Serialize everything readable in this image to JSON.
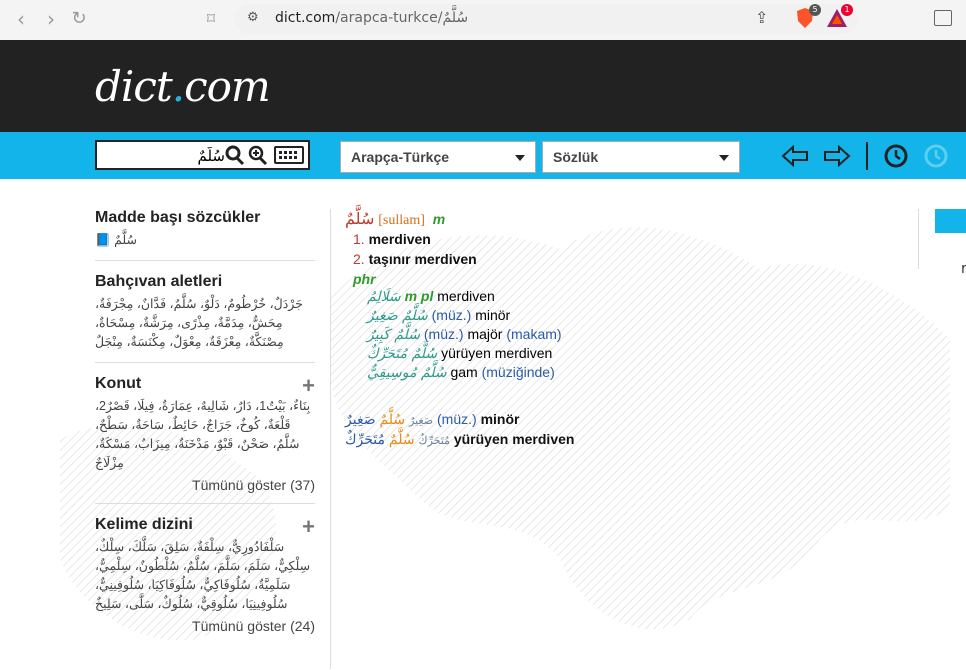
{
  "browser": {
    "url_host": "dict.com",
    "url_path": "/arapca-turkce/سُلَّمٌ",
    "brave_badge": "5",
    "bat_badge": "1"
  },
  "site": {
    "logo_main": "dict",
    "logo_dot": ".",
    "logo_tld": "com"
  },
  "search": {
    "value": "سُلَّمٌ",
    "language_pair": "Arapça-Türkçe",
    "dictionary": "Sözlük"
  },
  "sidebar": {
    "headwords": {
      "title": "Madde başı sözcükler",
      "items_text": "سُلَّمٌ"
    },
    "garden": {
      "title": "Bahçıvan aletleri",
      "text": "جَرْدَلٌ، خُرْطُومٌ، دَلْوٌ، سُلَّمٌ، فَدَّانٌ، مِجْرَفَةٌ، مِحَشٌّ، مِدَمَّةٌ، مِذْرًى، مِرَشَّةٌ، مِسْحَاةٌ، مِصْنَكَّةٌ، مِعْزَقَةٌ، مِعْوَلٌ، مِكْنَسَةٌ، مِنْجَلٌ"
    },
    "housing": {
      "title": "Konut",
      "text": "بِنَاءٌ، بَيْتٌ1، دَارٌ، شَالِيهٌ، عِمَارَةٌ، فِيلَا، قَصْرٌ2، قَلْعَةٌ، كُوخٌ، جَرَاجٌ، حَائِطٌ، سَاحَةٌ، سَطْحٌ، سُلَّمٌ، صَحْنٌ، قَبْوٌ، مَدْخَنَةٌ، مِيزَابٌ، مَسْكَةٌ، مِزْلَاجٌ",
      "show_all": "Tümünü göster (37)"
    },
    "index": {
      "title": "Kelime dizini",
      "text": "سَلْفَادُورِيٌّ، سِلْفَةٌ، سَلِقَ، سَلَّكَ، سِلْكٌ، سِلْكِيٌّ، سَلَمَ، سَلَّمَ، سُلَّمٌ، سُلْطُونٌ، سِلْمِيٌّ، سَلَمِيَّةٌ، سُلُوفَاكِيٌّ، سُلُوفَاكِيَا، سُلُوفِينِيٌّ، سُلُوفِينِيَا، سُلُوقِيٌّ، سُلُوكٌ، سَلَّى، سَلِيخٌ",
      "show_all": "Tümünü göster (24)"
    }
  },
  "entry": {
    "headword": "سُلَّمٌ",
    "transcription": "[sullam]",
    "gender": "m",
    "senses": [
      {
        "n": "1.",
        "text": "merdiven"
      },
      {
        "n": "2.",
        "text": "taşınır merdiven"
      }
    ],
    "phr_label": "phr",
    "phrases": [
      {
        "ar": "سَلَالِمُ",
        "pos": "m pl",
        "tr": "merdiven",
        "note": ""
      },
      {
        "ar": "سُلَّمٌ صَغِيرٌ",
        "muz": "(müz.)",
        "tr": "minör",
        "note": ""
      },
      {
        "ar": "سُلَّمٌ كَبِيرٌ",
        "muz": "(müz.)",
        "tr": "majör",
        "note": "(makam)"
      },
      {
        "ar": "سُلَّمٌ مُتَحَرِّكٌ",
        "tr": "yürüyen merdiven",
        "note": ""
      },
      {
        "ar": "سُلَّمٌ مُوسِيقِيٌّ",
        "tr": "gam",
        "note": "(müziğinde)"
      }
    ],
    "extra": [
      {
        "small": "صَغِيرٌ",
        "head": "سُلَّمٌ",
        "ar": "صَغِيرٌ",
        "muz": "(müz.)",
        "tr": "minör"
      },
      {
        "small": "مُتَحَرِّكٌ",
        "head": "سُلَّمٌ",
        "ar": "مُتَحَرِّكٌ",
        "tr": "yürüyen merdiven"
      }
    ]
  },
  "colors": {
    "brand_blue": "#12b4ea",
    "header_dark": "#222222",
    "headword_red": "#c0392b"
  }
}
